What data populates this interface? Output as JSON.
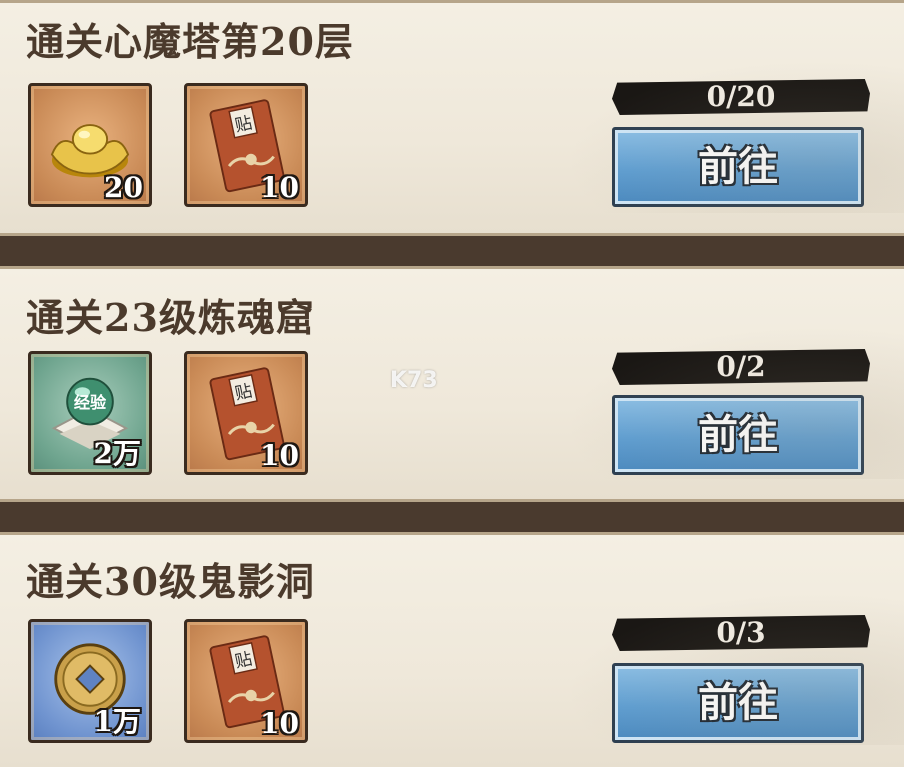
{
  "tasks": [
    {
      "title": "通关心魔塔第20层",
      "rewards": [
        {
          "icon": "gold-ingot-icon",
          "qty": "20"
        },
        {
          "icon": "red-envelope-icon",
          "qty": "10"
        }
      ],
      "progress": "0/20",
      "button": "前往"
    },
    {
      "title": "通关23级炼魂窟",
      "rewards": [
        {
          "icon": "experience-orb-icon",
          "qty": "2万",
          "label": "经验"
        },
        {
          "icon": "red-envelope-icon",
          "qty": "10"
        }
      ],
      "progress": "0/2",
      "button": "前往"
    },
    {
      "title": "通关30级鬼影洞",
      "rewards": [
        {
          "icon": "copper-coin-icon",
          "qty": "1万"
        },
        {
          "icon": "red-envelope-icon",
          "qty": "10"
        }
      ],
      "progress": "0/3",
      "button": "前往"
    }
  ],
  "envelope_char": "贴",
  "watermark": "K73"
}
